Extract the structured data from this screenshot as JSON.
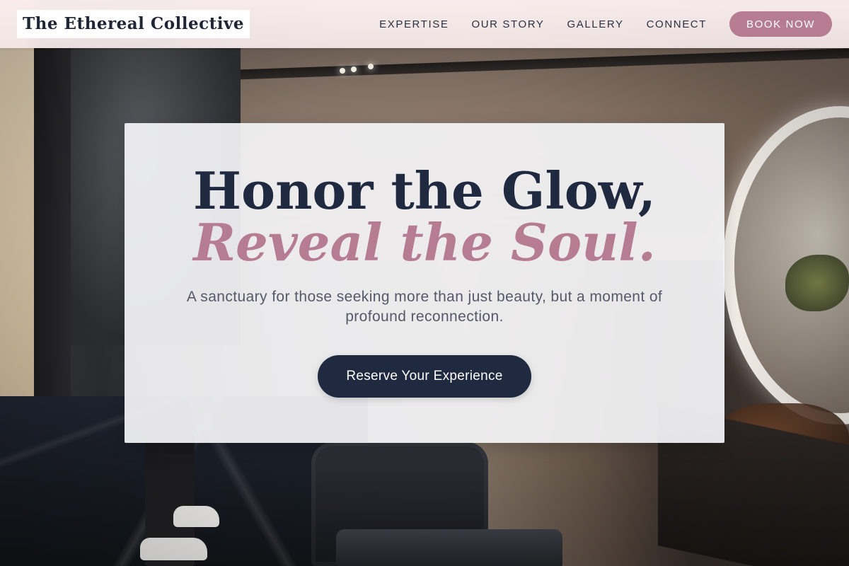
{
  "header": {
    "logo_text": "The Ethereal Collective",
    "nav": [
      {
        "label": "EXPERTISE"
      },
      {
        "label": "OUR STORY"
      },
      {
        "label": "GALLERY"
      },
      {
        "label": "CONNECT"
      }
    ],
    "cta_label": "BOOK NOW"
  },
  "hero": {
    "headline_line1": "Honor the Glow,",
    "headline_line2": "Reveal the Soul.",
    "subtitle": "A sanctuary for those seeking more than just beauty, but a moment of profound reconnection.",
    "cta_label": "Reserve Your Experience"
  },
  "colors": {
    "navy": "#1f2a40",
    "mauve": "#b57c92",
    "header_bg": "#fcf0f0"
  }
}
